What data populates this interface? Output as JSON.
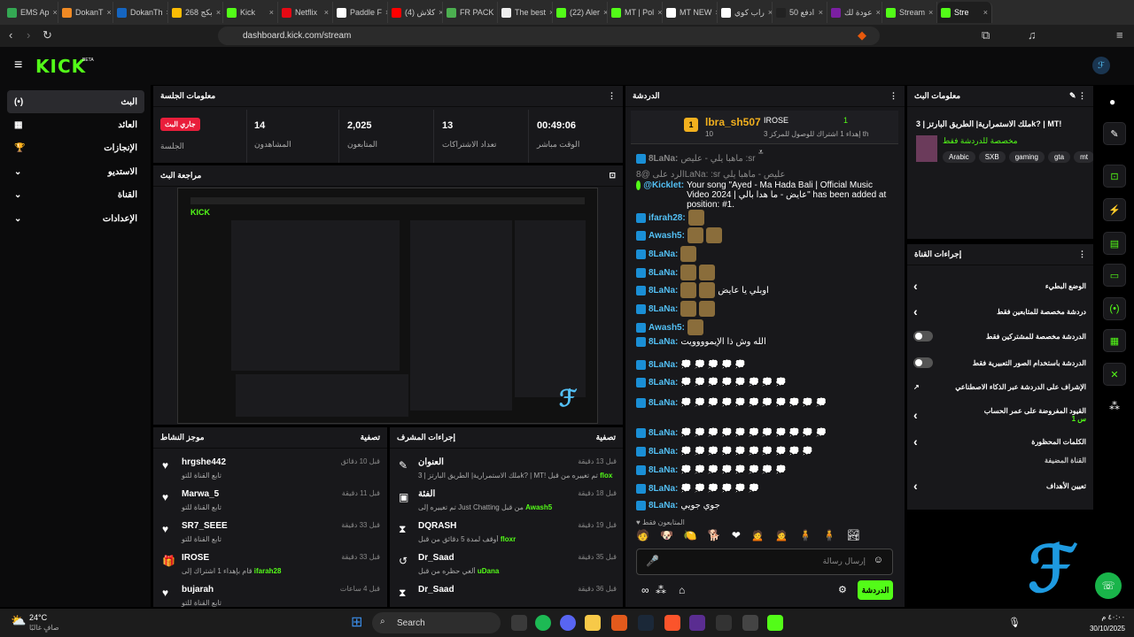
{
  "browser": {
    "tabs": [
      {
        "label": "EMS Ap",
        "color": "#34a853"
      },
      {
        "label": "DokanT",
        "color": "#f08a24"
      },
      {
        "label": "DokanTh",
        "color": "#1565c0"
      },
      {
        "label": "بكج 268",
        "color": "#fbbc04"
      },
      {
        "label": "Kick",
        "color": "#53fc18"
      },
      {
        "label": "Netflix",
        "color": "#e50914"
      },
      {
        "label": "Paddle F",
        "color": "#ffffff"
      },
      {
        "label": "(4) كلاش",
        "color": "#ff0000"
      },
      {
        "label": "FR PACK",
        "color": "#4caf50"
      },
      {
        "label": "The best",
        "color": "#eeeeee"
      },
      {
        "label": "(22) Aler",
        "color": "#53fc18"
      },
      {
        "label": "MT | Pol",
        "color": "#53fc18"
      },
      {
        "label": "MT NEW",
        "color": "#ffffff"
      },
      {
        "label": "راب كوي",
        "color": "#ffffff"
      },
      {
        "label": "ادفع 50",
        "color": "#222222"
      },
      {
        "label": "عودة لك",
        "color": "#7b1fa2"
      },
      {
        "label": "Stream",
        "color": "#53fc18"
      },
      {
        "label": "Stre",
        "color": "#53fc18"
      }
    ],
    "url": "dashboard.kick.com/stream"
  },
  "brand": {
    "logo": "KICK",
    "badge": "BETA",
    "accent": "#53fc18"
  },
  "sidebar": {
    "items": [
      {
        "label": "البث",
        "icon": "(•)"
      },
      {
        "label": "العائد",
        "icon": "▦"
      },
      {
        "label": "الإنجازات",
        "icon": "🏆"
      },
      {
        "label": "الاستديو",
        "icon": "⌄"
      },
      {
        "label": "القناة",
        "icon": "⌄"
      },
      {
        "label": "الإعدادات",
        "icon": "⌄"
      }
    ]
  },
  "session": {
    "title": "معلومات الجلسة",
    "live_badge": "جاري البث",
    "session_label": "الجلسة",
    "stats": [
      {
        "value": "14",
        "label": "المشاهدون"
      },
      {
        "value": "2,025",
        "label": "المتابعون"
      },
      {
        "value": "13",
        "label": "تعداد الاشتراكات"
      },
      {
        "value": "00:49:06",
        "label": "الوقت مباشر"
      }
    ]
  },
  "preview": {
    "title": "مراجعة البث"
  },
  "activity": {
    "title": "موجز النشاط",
    "filter": "تصفية",
    "items": [
      {
        "name": "hrgshe442",
        "time": "قبل 10 دقائق",
        "desc": "تابع القناة للتو",
        "icon": "♥"
      },
      {
        "name": "Marwa_5",
        "time": "قبل 11 دقيقة",
        "desc": "تابع القناة للتو",
        "icon": "♥"
      },
      {
        "name": "SR7_SEEE",
        "time": "قبل 33 دقيقة",
        "desc": "تابع القناة للتو",
        "icon": "♥"
      },
      {
        "name": "IROSE",
        "time": "قبل 33 دقيقة",
        "desc": "قام بإهداء 1 اشتراك إلى",
        "hl": "ifarah28",
        "icon": "🎁"
      },
      {
        "name": "bujarah",
        "time": "قبل 4 ساعات",
        "desc": "تابع القناة للتو",
        "icon": "♥"
      }
    ]
  },
  "modactions": {
    "title": "إجراءات المشرف",
    "filter": "تصفية",
    "items": [
      {
        "name": "العنوان",
        "time": "قبل 13 دقيقة",
        "desc": "ملك الاستمرارية| الطريق البارتز | 3k? | MT! تم تغييره من قبل",
        "hl": "floxr",
        "icon": "✎"
      },
      {
        "name": "الفئة",
        "time": "قبل 18 دقيقة",
        "desc": "تم تغييره إلى Just Chatting من قبل",
        "hl": "Awash5",
        "icon": "▣"
      },
      {
        "name": "DQRASH",
        "time": "قبل 19 دقيقة",
        "desc": "أوقف لمدة 5 دقائق من قبل",
        "hl": "floxr",
        "icon": "⧗"
      },
      {
        "name": "Dr_Saad",
        "time": "قبل 35 دقيقة",
        "desc": "ألغي حظره من قبل",
        "hl": "uDana",
        "icon": "↺"
      },
      {
        "name": "Dr_Saad",
        "time": "قبل 36 دقيقة",
        "desc": "",
        "hl": "",
        "icon": "⧗"
      }
    ]
  },
  "chat": {
    "title": "الدردشة",
    "pinned": {
      "user": "lbra_sh507",
      "count": "10",
      "gifter": "IROSE",
      "gift_count": "1",
      "gift_text": "إهداء 1 اشتراك للوصول للمركز 3 th"
    },
    "lines": [
      {
        "user": "8LaNa:",
        "text": "ماهبا يلي - عليص :sr",
        "type": "dim"
      },
      {
        "user": "",
        "text": "الرد على @8LaNa: :sr عليص - ماهبا يلي",
        "type": "reply"
      },
      {
        "user": "@Kicklet:",
        "text": "Your song \"Ayed - Ma Hada Bali | Official Music Video 2024 | عايض - ما هدا بالي\" has been added at position: #1.",
        "type": "bot"
      },
      {
        "user": "ifarah28:",
        "text": "",
        "type": "emote"
      },
      {
        "user": "Awash5:",
        "text": "",
        "type": "emote2"
      },
      {
        "user": "8LaNa:",
        "text": "",
        "type": "emote"
      },
      {
        "user": "8LaNa:",
        "text": "",
        "type": "emote2"
      },
      {
        "user": "8LaNa:",
        "text": "اوبلي يا عايض",
        "type": "emote2"
      },
      {
        "user": "8LaNa:",
        "text": "",
        "type": "emote2"
      },
      {
        "user": "Awash5:",
        "text": "",
        "type": "emote"
      },
      {
        "user": "8LaNa:",
        "text": "الله وش ذا الإيموووويت",
        "type": "text"
      },
      {
        "user": "8LaNa:",
        "text": "💭 💭 💭 💭 💭",
        "type": "bub"
      },
      {
        "user": "8LaNa:",
        "text": "💭 💭 💭 💭 💭 💭 💭 💭",
        "type": "bub"
      },
      {
        "user": "8LaNa:",
        "text": "💭 💭 💭 💭 💭 💭 💭 💭 💭 💭 💭",
        "type": "bub"
      },
      {
        "user": "8LaNa:",
        "text": "💭 💭 💭 💭 💭 💭 💭 💭 💭 💭 💭",
        "type": "bub"
      },
      {
        "user": "8LaNa:",
        "text": "💭 💭 💭 💭 💭 💭 💭 💭 💭 💭",
        "type": "bub"
      },
      {
        "user": "8LaNa:",
        "text": "💭 💭 💭 💭 💭 💭 💭 💭",
        "type": "bub"
      },
      {
        "user": "8LaNa:",
        "text": "💭 💭 💭 💭 💭 💭",
        "type": "bub"
      },
      {
        "user": "8LaNa:",
        "text": "جوي جويي",
        "type": "text"
      }
    ],
    "followers_only": "المتابعون فقط",
    "input_placeholder": "إرسال رسالة",
    "send": "الدردشة"
  },
  "streaminfo": {
    "title": "معلومات البث",
    "stream_title": "ملك الاستمرارية| الطريق البارتز | 3k? | MT!",
    "category": "مخصصة للدردشة فقط",
    "tags": [
      "Arabic",
      "SXB",
      "gaming",
      "gta",
      "mt"
    ]
  },
  "channelactions": {
    "title": "إجراءات القناة",
    "items": [
      {
        "label": "الوضع البطيء",
        "ctrl": "chevron"
      },
      {
        "label": "دردشة مخصصة للمتابعين فقط",
        "ctrl": "chevron"
      },
      {
        "label": "الدردشة مخصصة للمشتركين فقط",
        "ctrl": "toggle"
      },
      {
        "label": "الدردشة باستخدام الصور التعبيرية فقط",
        "ctrl": "toggle"
      },
      {
        "label": "الإشراف على الدردشة عبر الذكاء الاصطناعي",
        "ctrl": "ext"
      },
      {
        "label": "القيود المفروضة على عمر الحساب",
        "ctrl": "chevron",
        "sub": "1 س"
      },
      {
        "label": "الكلمات المحظورة",
        "ctrl": "chevron"
      },
      {
        "label": "القناة المضيفة",
        "ctrl": "none"
      },
      {
        "label": "تعيين الأهداف",
        "ctrl": "chevron"
      }
    ]
  },
  "taskbar": {
    "weather_temp": "24°C",
    "weather_desc": "صافٍ غالبًا",
    "search": "Search",
    "time": "٤٠:٠٠ م",
    "date": "30/10/2025"
  }
}
